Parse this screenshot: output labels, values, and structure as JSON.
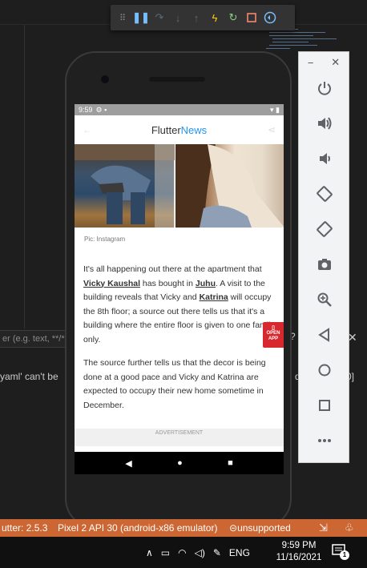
{
  "ide": {
    "filter_placeholder": "er (e.g. text, **/*",
    "error_message": "yaml' can't be",
    "right_snippet_1": "d",
    "right_snippet_2": "0]",
    "close_label": "✕",
    "help_label": "?"
  },
  "status_bar": {
    "flutter_version": "utter: 2.5.3",
    "device": "Pixel 2 API 30 (android-x86 emulator)",
    "support": "unsupported"
  },
  "taskbar": {
    "language": "ENG",
    "time": "9:59 PM",
    "date": "11/16/2021",
    "notification_count": "1"
  },
  "phone": {
    "status_time": "9:59",
    "app_title_part1": "Flutter",
    "app_title_part2": "News",
    "photo_caption": "Pic: Instagram",
    "paragraph1": {
      "t1": "It's all happening out there at the apartment that ",
      "link1": "Vicky Kaushal",
      "t2": " has bought in ",
      "link2": "Juhu",
      "t3": ". A visit to the building reveals that Vicky and ",
      "link3": "Katrina",
      "t4": " will occupy the 8th floor; a source out there tells us that it's a building where the entire floor is given to one family only."
    },
    "paragraph2": "The source further tells us that the decor is being done at a good pace and Vicky and Katrina are expected to occupy their new home sometime in December.",
    "advertisement_label": "ADVERTISEMENT",
    "open_app_label_1": "OPEN",
    "open_app_label_2": "APP"
  },
  "colors": {
    "status_bar": "#cc6633",
    "brand_blue": "#2196f3",
    "open_app_red": "#d7282f"
  }
}
